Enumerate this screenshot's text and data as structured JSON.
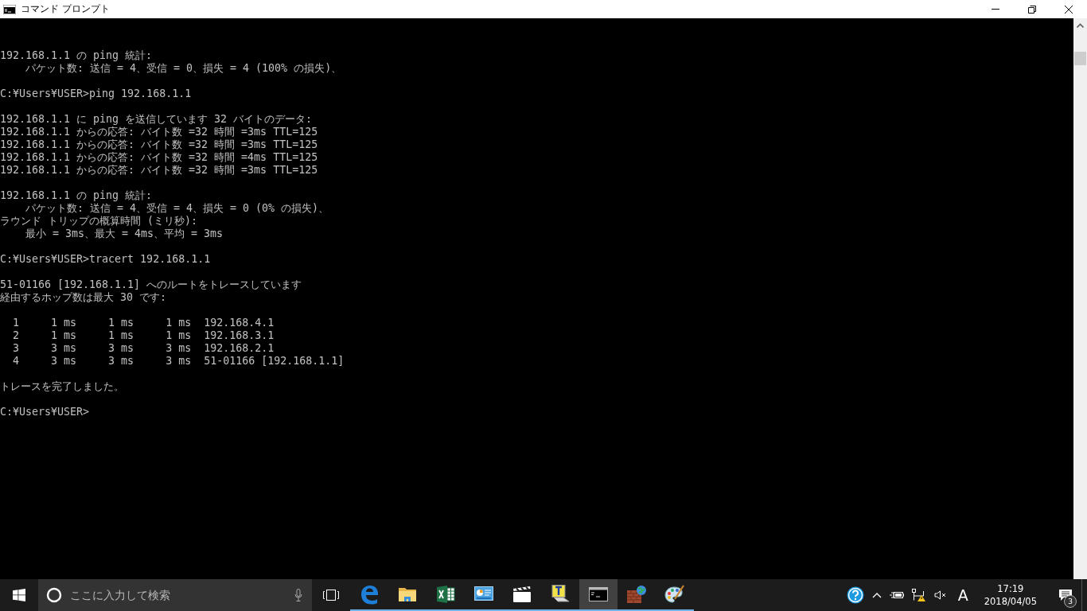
{
  "window": {
    "title": "コマンド プロンプト"
  },
  "console": {
    "blocks": [
      [
        "192.168.1.1 の ping 統計:",
        "    パケット数: 送信 = 4、受信 = 0、損失 = 4 (100% の損失)、"
      ],
      [
        "C:¥Users¥USER>ping 192.168.1.1"
      ],
      [
        "192.168.1.1 に ping を送信しています 32 バイトのデータ:",
        "192.168.1.1 からの応答: バイト数 =32 時間 =3ms TTL=125",
        "192.168.1.1 からの応答: バイト数 =32 時間 =3ms TTL=125",
        "192.168.1.1 からの応答: バイト数 =32 時間 =4ms TTL=125",
        "192.168.1.1 からの応答: バイト数 =32 時間 =3ms TTL=125"
      ],
      [
        "192.168.1.1 の ping 統計:",
        "    パケット数: 送信 = 4、受信 = 4、損失 = 0 (0% の損失)、",
        "ラウンド トリップの概算時間 (ミリ秒):",
        "    最小 = 3ms、最大 = 4ms、平均 = 3ms"
      ],
      [
        "C:¥Users¥USER>tracert 192.168.1.1"
      ],
      [
        "51-01166 [192.168.1.1] へのルートをトレースしています",
        "経由するホップ数は最大 30 です:"
      ],
      [
        "  1     1 ms     1 ms     1 ms  192.168.4.1",
        "  2     1 ms     1 ms     1 ms  192.168.3.1",
        "  3     3 ms     3 ms     3 ms  192.168.2.1",
        "  4     3 ms     3 ms     3 ms  51-01166 [192.168.1.1]"
      ],
      [
        "トレースを完了しました。"
      ],
      [
        "C:¥Users¥USER>"
      ]
    ]
  },
  "taskbar": {
    "search": {
      "placeholder": "ここに入力して検索"
    },
    "apps": [
      {
        "kind": "edge",
        "running": true,
        "selected": false
      },
      {
        "kind": "folder",
        "running": true,
        "selected": false
      },
      {
        "kind": "spreadsheet",
        "running": true,
        "selected": false
      },
      {
        "kind": "panel",
        "running": true,
        "selected": false
      },
      {
        "kind": "clapper",
        "running": true,
        "selected": false
      },
      {
        "kind": "tfile",
        "running": true,
        "selected": false
      },
      {
        "kind": "console",
        "running": true,
        "selected": true
      },
      {
        "kind": "firewall",
        "running": true,
        "selected": false
      },
      {
        "kind": "palette",
        "running": true,
        "selected": false
      }
    ],
    "tray": {
      "ime": "A",
      "time": "17:19",
      "date": "2018/04/05",
      "notifications": "3"
    }
  }
}
